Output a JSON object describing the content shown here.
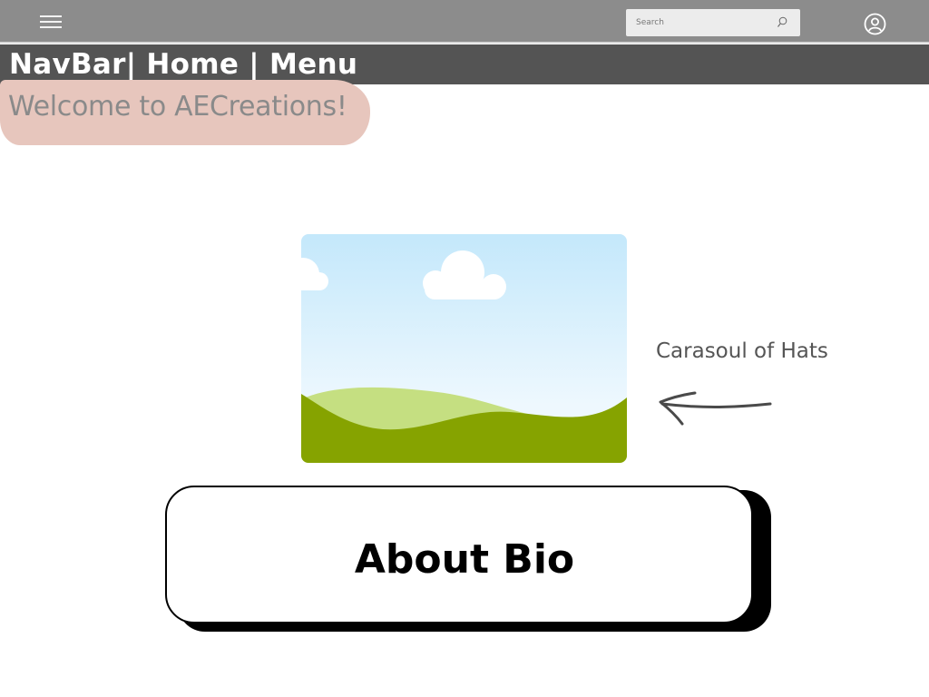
{
  "header": {
    "menu_icon": "hamburger-menu-icon",
    "search_placeholder": "Search",
    "search_icon": "search-icon",
    "profile_icon": "user-circle-icon"
  },
  "navbar": {
    "title": "NavBar| Home | Menu"
  },
  "welcome": {
    "text": "Welcome to AECreations!",
    "highlight_color": "#e7c6bd"
  },
  "carousel": {
    "image_icon": "landscape-placeholder-image",
    "label": "Carasoul of Hats",
    "arrow_icon": "left-arrow-icon"
  },
  "bio": {
    "label": "About Bio"
  },
  "colors": {
    "topbar": "#8c8c8c",
    "navbar": "#545454",
    "sky_top": "#c4e8fb",
    "grass_light": "#c5df81",
    "grass_dark": "#86a300"
  }
}
